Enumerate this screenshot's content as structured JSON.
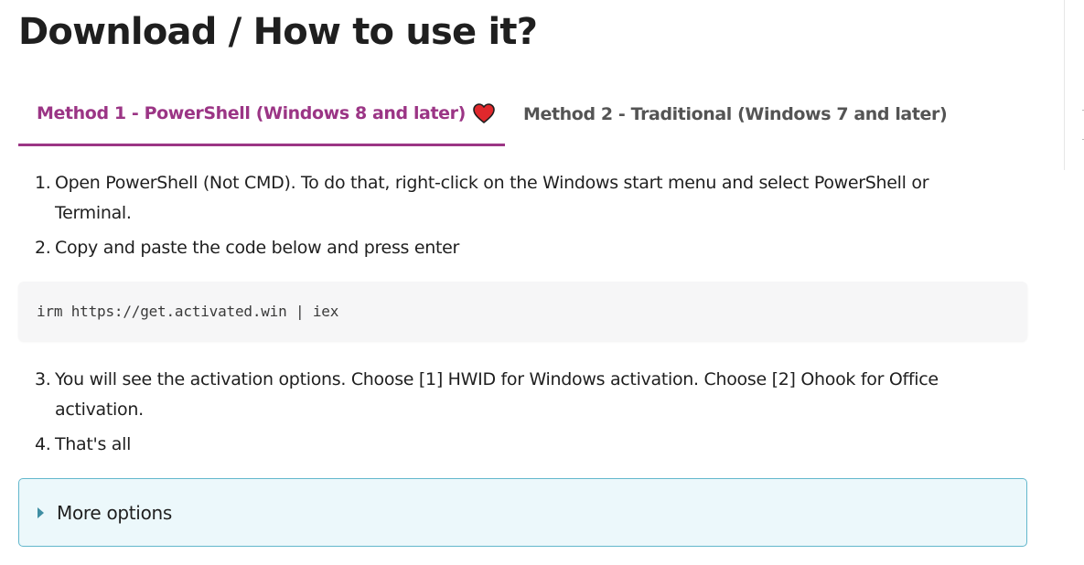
{
  "page_title": "Download / How to use it?",
  "tabs": [
    {
      "label": "Method 1 - PowerShell (Windows 8 and later)",
      "active": true,
      "icon": "heart-icon",
      "icon_color": "#e0282c"
    },
    {
      "label": "Method 2 - Traditional (Windows 7 and later)",
      "active": false
    }
  ],
  "steps_part1": [
    {
      "num": "1.",
      "text": "Open PowerShell (Not CMD). To do that, right-click on the Windows start menu and select PowerShell or Terminal."
    },
    {
      "num": "2.",
      "text": "Copy and paste the code below and press enter"
    }
  ],
  "code": "irm https://get.activated.win | iex",
  "steps_part2": [
    {
      "num": "3.",
      "text": "You will see the activation options. Choose [1] HWID for Windows activation. Choose [2] Ohook for Office activation."
    },
    {
      "num": "4.",
      "text": "That's all"
    }
  ],
  "details": {
    "label": "More options",
    "icon": "chevron-right-icon",
    "expanded": false
  },
  "colors": {
    "accent": "#9b3585",
    "inactive_tab": "#545454",
    "details_bg": "#ecf8fb",
    "details_border": "#62b7cc"
  }
}
